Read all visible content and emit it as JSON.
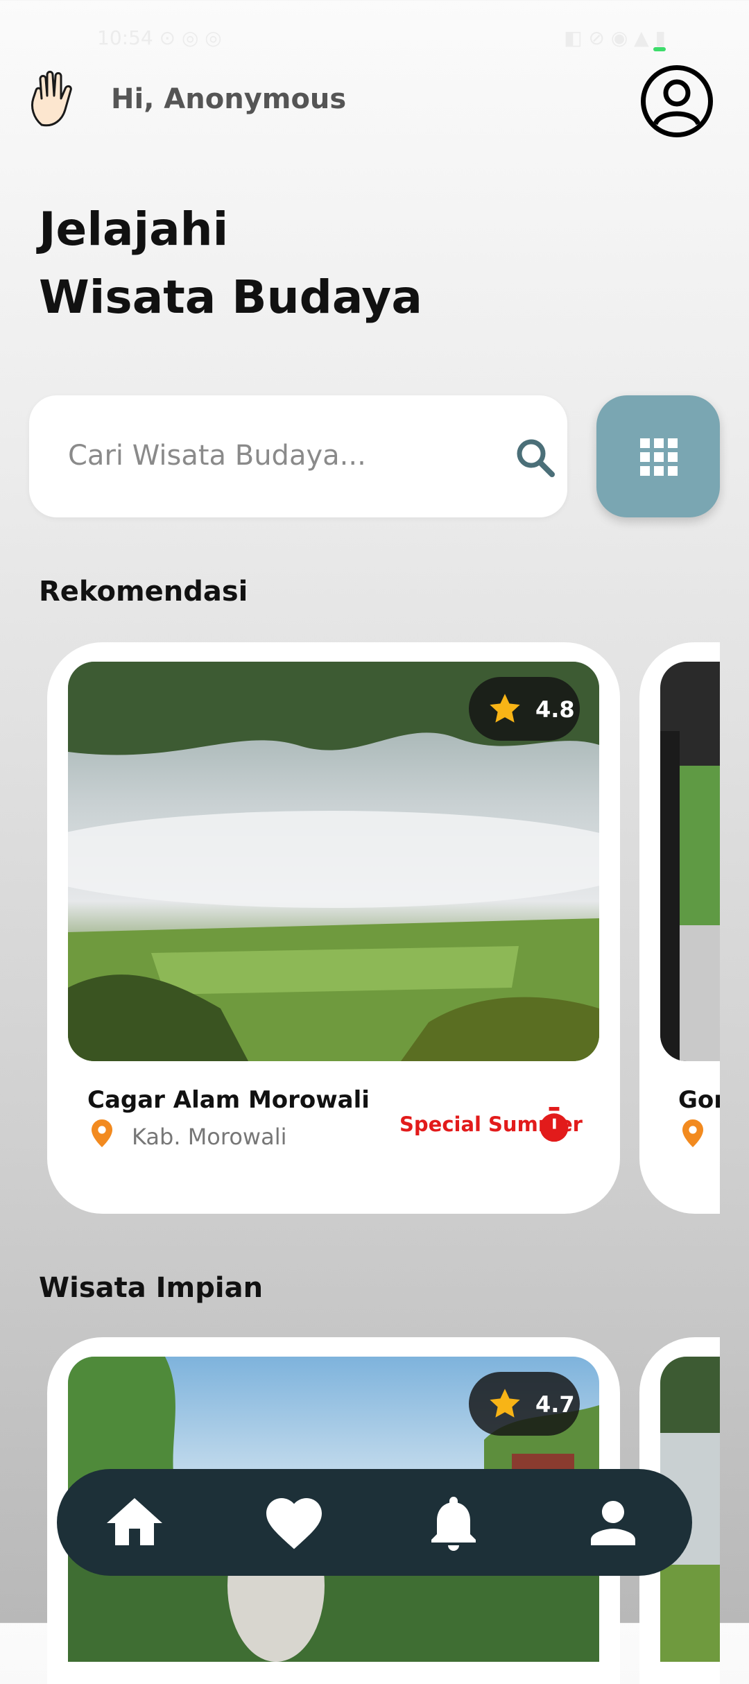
{
  "status_bar": {
    "left": "10:54 ⊙ ◎ ◎",
    "right": "◧ ⊘ ◉ ▲ ▮"
  },
  "header": {
    "greeting": "Hi, Anonymous",
    "profile_icon": "account-circle-icon"
  },
  "hero": {
    "line1": "Jelajahi",
    "line2": "Wisata Budaya"
  },
  "search": {
    "placeholder": "Cari Wisata Budaya...",
    "icon": "search-icon"
  },
  "filter_button": {
    "icon": "grid-icon",
    "color": "#7aa6b2"
  },
  "sections": {
    "recommend": {
      "title": "Rekomendasi",
      "cards": [
        {
          "name": "Cagar Alam Morowali",
          "location": "Kab. Morowali",
          "rating": "4.8",
          "badge": "Special Summer"
        },
        {
          "name": "Gonc",
          "location": "",
          "rating": "",
          "badge": ""
        }
      ]
    },
    "dream": {
      "title": "Wisata Impian",
      "cards": [
        {
          "rating": "4.7"
        },
        {
          "rating": ""
        }
      ]
    }
  },
  "bottom_nav": {
    "items": [
      "home-icon",
      "heart-icon",
      "bell-icon",
      "person-icon"
    ],
    "background": "#1d3038"
  },
  "colors": {
    "accent_red": "#e21b1b",
    "pin_orange": "#f28a1f",
    "star": "#f8b416"
  }
}
